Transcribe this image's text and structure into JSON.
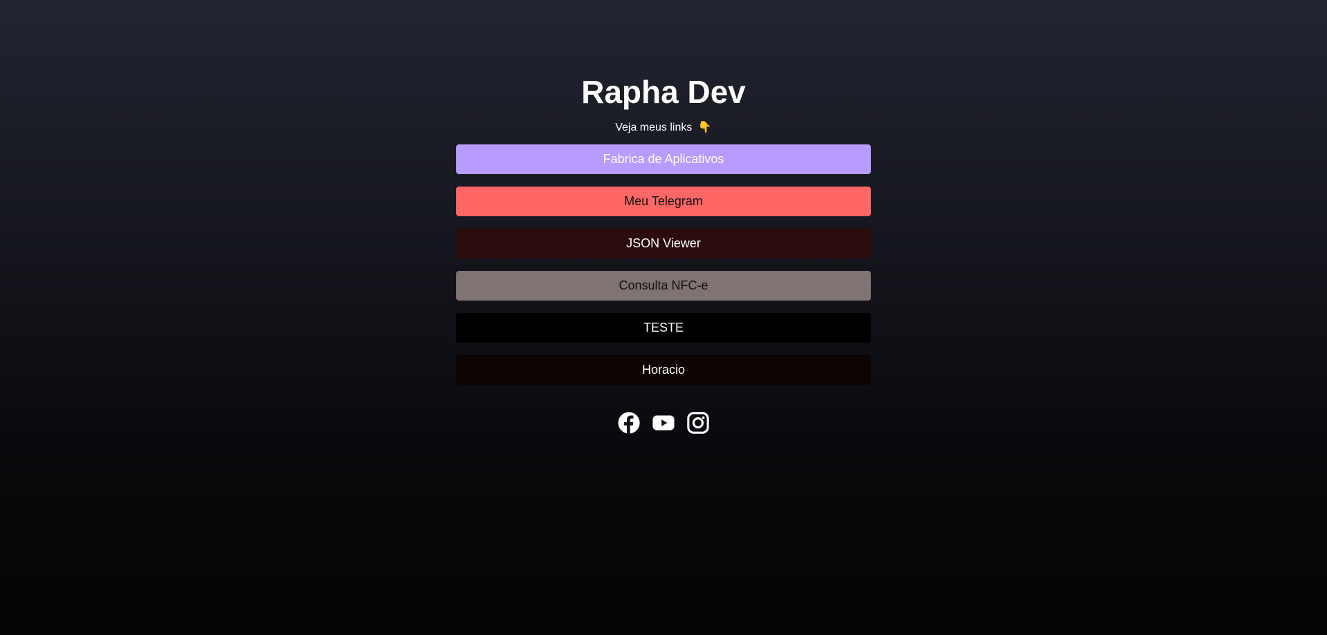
{
  "profile": {
    "title": "Rapha Dev",
    "subtitle": "Veja meus links",
    "subtitle_emoji": "👇"
  },
  "links": [
    {
      "label": "Fabrica de Aplicativos",
      "bg": "#b79bff",
      "color": "#ffffff"
    },
    {
      "label": "Meu Telegram",
      "bg": "#ff6666",
      "color": "#111111"
    },
    {
      "label": "JSON Viewer",
      "bg": "#2b0b0b",
      "color": "#ffffff"
    },
    {
      "label": "Consulta NFC-e",
      "bg": "#7f7373",
      "color": "#111111"
    },
    {
      "label": "TESTE",
      "bg": "#000000",
      "color": "#ffffff"
    },
    {
      "label": "Horacio",
      "bg": "#0d0302",
      "color": "#ffffff"
    }
  ],
  "socials": [
    {
      "icon": "facebook-icon"
    },
    {
      "icon": "youtube-icon"
    },
    {
      "icon": "instagram-icon"
    }
  ],
  "colors": {
    "icon": "#ffffff"
  }
}
